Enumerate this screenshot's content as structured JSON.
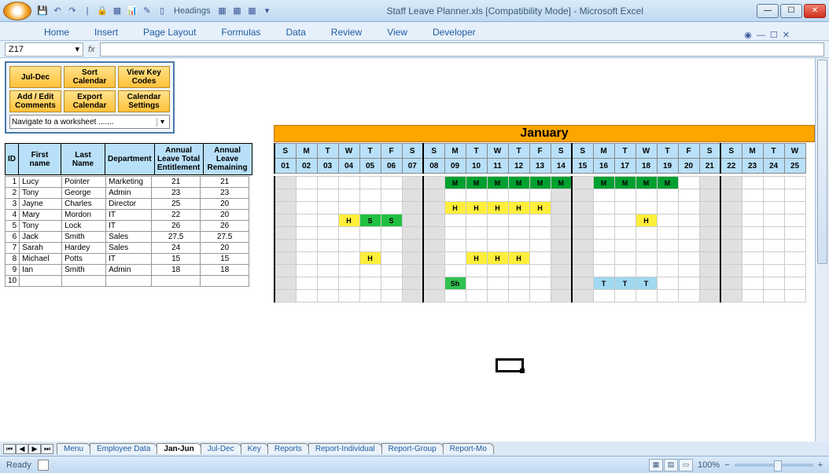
{
  "window": {
    "title": "Staff Leave Planner.xls  [Compatibility Mode] - Microsoft Excel",
    "qat_label": "Headings",
    "min": "—",
    "max": "☐",
    "close": "✕"
  },
  "ribbon": {
    "tabs": [
      "Home",
      "Insert",
      "Page Layout",
      "Formulas",
      "Data",
      "Review",
      "View",
      "Developer"
    ]
  },
  "formula": {
    "namebox": "Z17",
    "fx": "fx"
  },
  "toolpanel": {
    "row1": [
      "Jul-Dec",
      "Sort Calendar",
      "View Key Codes"
    ],
    "row2": [
      "Add / Edit Comments",
      "Export Calendar",
      "Calendar Settings"
    ],
    "nav": "Navigate to a worksheet ......."
  },
  "month": "January",
  "headers": {
    "id": "ID",
    "first": "First name",
    "last": "Last Name",
    "dept": "Department",
    "al1": "Annual Leave Total Entitlement",
    "al2": "Annual Leave Remaining"
  },
  "weekdays": [
    "S",
    "M",
    "T",
    "W",
    "T",
    "F",
    "S",
    "S",
    "M",
    "T",
    "W",
    "T",
    "F",
    "S",
    "S",
    "M",
    "T",
    "W",
    "T",
    "F",
    "S",
    "S",
    "M",
    "T",
    "W"
  ],
  "daynums": [
    "01",
    "02",
    "03",
    "04",
    "05",
    "06",
    "07",
    "08",
    "09",
    "10",
    "11",
    "12",
    "13",
    "14",
    "15",
    "16",
    "17",
    "18",
    "19",
    "20",
    "21",
    "22",
    "23",
    "24",
    "25"
  ],
  "staff": [
    {
      "id": "1",
      "first": "Lucy",
      "last": "Pointer",
      "dept": "Marketing",
      "al1": "21",
      "al2": "21"
    },
    {
      "id": "2",
      "first": "Tony",
      "last": "George",
      "dept": "Admin",
      "al1": "23",
      "al2": "23"
    },
    {
      "id": "3",
      "first": "Jayne",
      "last": "Charles",
      "dept": "Director",
      "al1": "25",
      "al2": "20"
    },
    {
      "id": "4",
      "first": "Mary",
      "last": "Mordon",
      "dept": "IT",
      "al1": "22",
      "al2": "20"
    },
    {
      "id": "5",
      "first": "Tony",
      "last": "Lock",
      "dept": "IT",
      "al1": "26",
      "al2": "26"
    },
    {
      "id": "6",
      "first": "Jack",
      "last": "Smith",
      "dept": "Sales",
      "al1": "27.5",
      "al2": "27.5"
    },
    {
      "id": "7",
      "first": "Sarah",
      "last": "Hardey",
      "dept": "Sales",
      "al1": "24",
      "al2": "20"
    },
    {
      "id": "8",
      "first": "Michael",
      "last": "Potts",
      "dept": "IT",
      "al1": "15",
      "al2": "15"
    },
    {
      "id": "9",
      "first": "Ian",
      "last": "Smith",
      "dept": "Admin",
      "al1": "18",
      "al2": "18"
    },
    {
      "id": "10",
      "first": "",
      "last": "",
      "dept": "",
      "al1": "",
      "al2": ""
    }
  ],
  "leave": {
    "0": {
      "8": "M",
      "9": "M",
      "10": "M",
      "11": "M",
      "12": "M",
      "13": "M",
      "15": "M",
      "16": "M",
      "17": "M",
      "18": "M"
    },
    "2": {
      "8": "H",
      "9": "H",
      "10": "H",
      "11": "H",
      "12": "H"
    },
    "3": {
      "3": "H",
      "4": "S",
      "5": "S",
      "17": "H"
    },
    "6": {
      "4": "H",
      "9": "H",
      "10": "H",
      "11": "H"
    },
    "8": {
      "8": "Sh",
      "15": "T",
      "16": "T",
      "17": "T"
    }
  },
  "sheet_tabs": [
    "Menu",
    "Employee Data",
    "Jan-Jun",
    "Jul-Dec",
    "Key",
    "Reports",
    "Report-Individual",
    "Report-Group",
    "Report-Mo"
  ],
  "active_tab": "Jan-Jun",
  "status": {
    "ready": "Ready",
    "zoom": "100%"
  }
}
